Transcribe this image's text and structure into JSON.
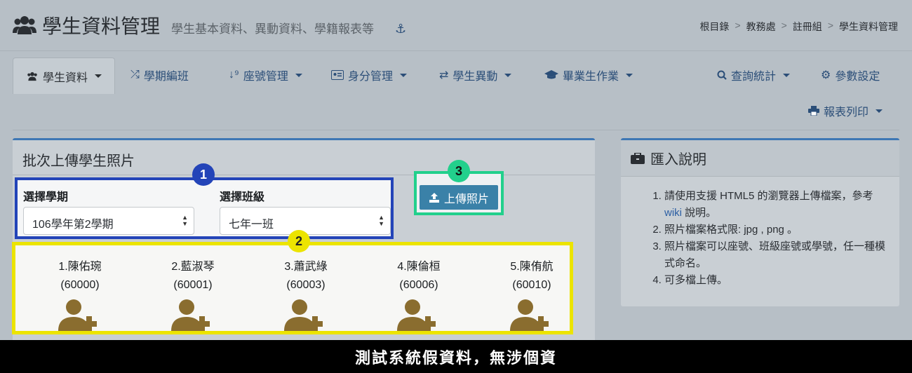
{
  "header": {
    "title": "學生資料管理",
    "subtitle": "學生基本資料、異動資料、學籍報表等",
    "breadcrumb": [
      "根目錄",
      "教務處",
      "註冊組",
      "學生資料管理"
    ]
  },
  "nav": {
    "items": [
      {
        "label": "學生資料",
        "icon": "users-icon",
        "active": true,
        "dropdown": true
      },
      {
        "label": "學期編班",
        "icon": "shuffle-icon",
        "active": false,
        "dropdown": false
      },
      {
        "label": "座號管理",
        "icon": "sort-numeric-icon",
        "active": false,
        "dropdown": true
      },
      {
        "label": "身分管理",
        "icon": "id-card-icon",
        "active": false,
        "dropdown": true
      },
      {
        "label": "學生異動",
        "icon": "exchange-icon",
        "active": false,
        "dropdown": true
      },
      {
        "label": "畢業生作業",
        "icon": "graduation-cap-icon",
        "active": false,
        "dropdown": true
      },
      {
        "label": "查詢統計",
        "icon": "search-icon",
        "active": false,
        "dropdown": true
      },
      {
        "label": "參數設定",
        "icon": "gear-icon",
        "active": false,
        "dropdown": false
      },
      {
        "label": "報表列印",
        "icon": "print-icon",
        "active": false,
        "dropdown": true
      }
    ]
  },
  "main": {
    "panel_title": "批次上傳學生照片",
    "semester_label": "選擇學期",
    "semester_value": "106學年第2學期",
    "class_label": "選擇班級",
    "class_value": "七年一班",
    "upload_label": "上傳照片",
    "students": [
      {
        "name": "1.陳佑琬",
        "id": "(60000)"
      },
      {
        "name": "2.藍淑琴",
        "id": "(60001)"
      },
      {
        "name": "3.蕭武綠",
        "id": "(60003)"
      },
      {
        "name": "4.陳倫桓",
        "id": "(60006)"
      },
      {
        "name": "5.陳侑航",
        "id": "(60010)"
      }
    ]
  },
  "help": {
    "title": "匯入說明",
    "items": [
      {
        "pre": "請使用支援 HTML5 的瀏覽器上傳檔案，參考 ",
        "link": "wiki",
        "post": " 說明。"
      },
      {
        "pre": "照片檔案格式限: jpg , png 。",
        "link": "",
        "post": ""
      },
      {
        "pre": "照片檔案可以座號、班級座號或學號，任一種模式命名。",
        "link": "",
        "post": ""
      },
      {
        "pre": "可多檔上傳。",
        "link": "",
        "post": ""
      }
    ]
  },
  "annotations": {
    "badge1": "1",
    "badge2": "2",
    "badge3": "3"
  },
  "footer": {
    "text": "測試系統假資料，無涉個資"
  },
  "colors": {
    "accent": "#2b4e78",
    "box_blue": "#2344b8",
    "box_yellow": "#ece400",
    "box_green": "#22d08c",
    "avatar": "#8a6d2f"
  }
}
